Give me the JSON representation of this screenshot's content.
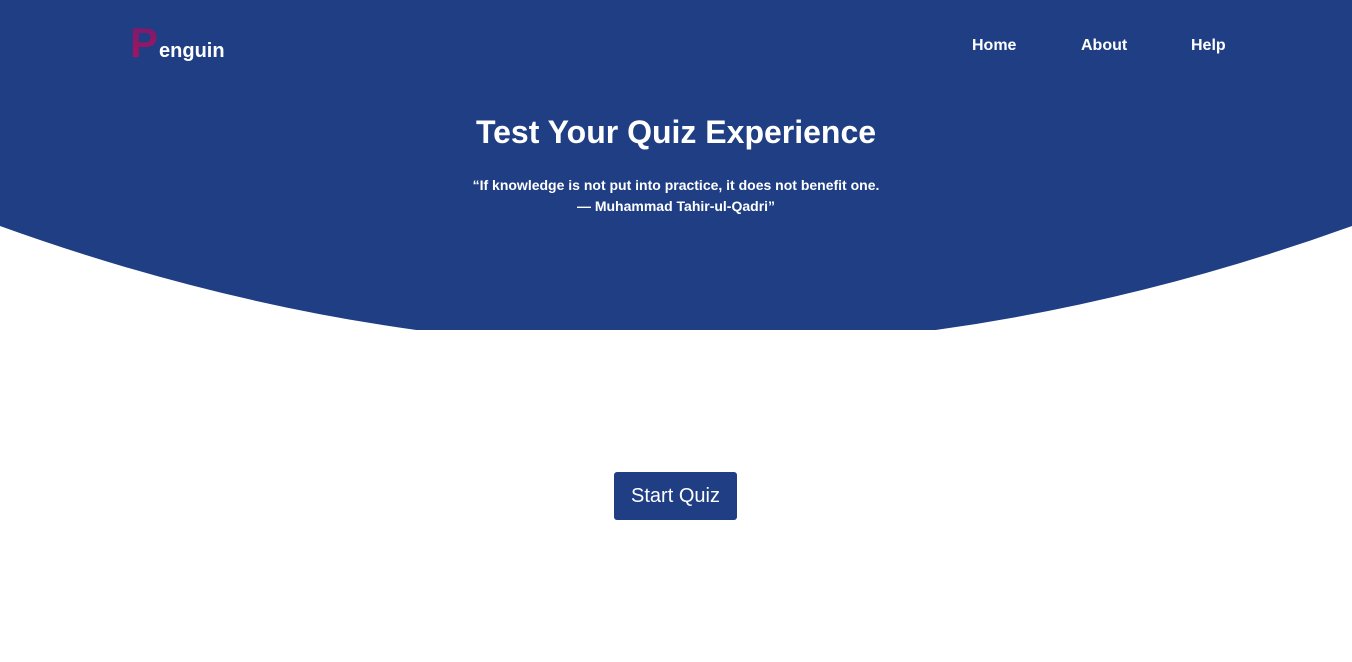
{
  "colors": {
    "hero_background": "#1f3e84",
    "button_background": "#1f3e84",
    "logo_letter_gradient_start": "#7a1a6e",
    "logo_letter_gradient_end": "#a8155e",
    "text_light": "#ffffff",
    "page_background": "#ffffff"
  },
  "header": {
    "logo": {
      "letter": "P",
      "rest": "enguin"
    },
    "nav": {
      "home": "Home",
      "about": "About",
      "help": "Help"
    }
  },
  "hero": {
    "title": "Test Your Quiz Experience",
    "quote_line1": "“If knowledge is not put into practice, it does not benefit one.",
    "quote_line2": "— Muhammad Tahir-ul-Qadri”"
  },
  "main": {
    "start_button_label": "Start Quiz"
  }
}
